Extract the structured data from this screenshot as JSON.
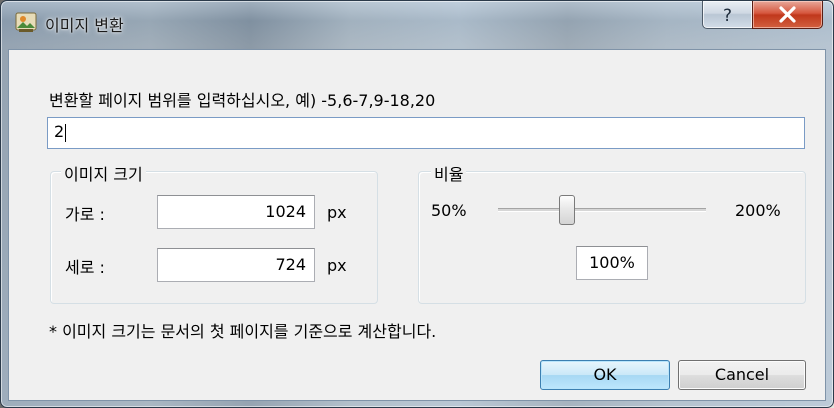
{
  "window": {
    "title": "이미지 변환",
    "help_glyph": "?",
    "close_glyph": "x"
  },
  "range": {
    "prompt": "변환할 페이지 범위를 입력하십시오, 예) -5,6-7,9-18,20",
    "value": "2"
  },
  "image_size": {
    "group_title": "이미지 크기",
    "width_label": "가로 :",
    "width_value": "1024",
    "width_unit": "px",
    "height_label": "세로 :",
    "height_value": "724",
    "height_unit": "px"
  },
  "ratio": {
    "group_title": "비율",
    "min_label": "50%",
    "max_label": "200%",
    "value": "100%",
    "slider_fraction": 0.33
  },
  "note": "* 이미지 크기는 문서의 첫 페이지를 기준으로 계산합니다.",
  "buttons": {
    "ok": "OK",
    "cancel": "Cancel"
  }
}
